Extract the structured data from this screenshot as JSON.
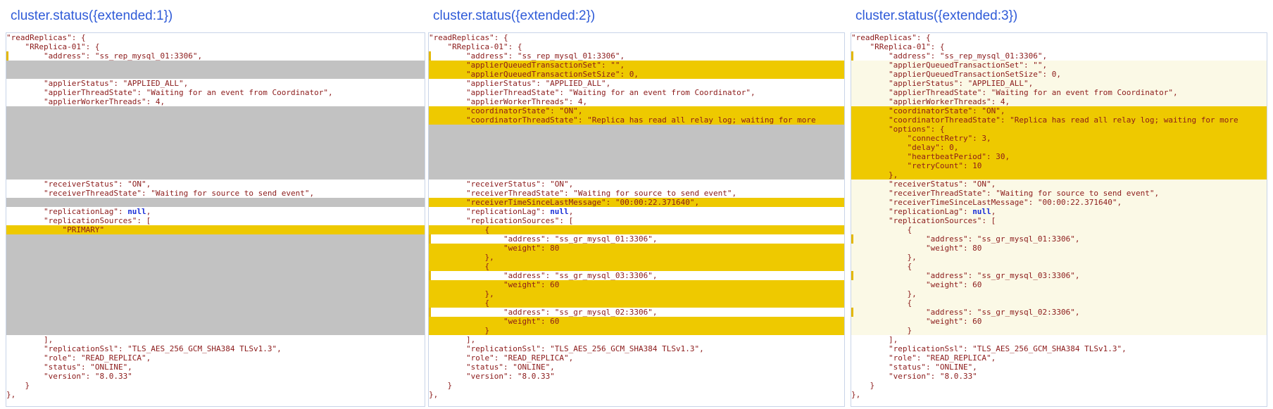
{
  "panels": [
    {
      "title": "cluster.status({extended:1})",
      "lines": [
        {
          "text": "\"readReplicas\": {",
          "hl": null
        },
        {
          "text": "    \"RReplica-01\": {",
          "hl": null
        },
        {
          "text": "        \"address\": \"ss_rep_mysql_01:3306\",",
          "hl": null,
          "mark": true
        },
        {
          "text": "",
          "hl": "grey"
        },
        {
          "text": "",
          "hl": "grey"
        },
        {
          "text": "        \"applierStatus\": \"APPLIED_ALL\",",
          "hl": null
        },
        {
          "text": "        \"applierThreadState\": \"Waiting for an event from Coordinator\",",
          "hl": null
        },
        {
          "text": "        \"applierWorkerThreads\": 4,",
          "hl": null
        },
        {
          "text": "",
          "hl": "grey"
        },
        {
          "text": "",
          "hl": "grey"
        },
        {
          "text": "",
          "hl": "grey"
        },
        {
          "text": "",
          "hl": "grey"
        },
        {
          "text": "",
          "hl": "grey"
        },
        {
          "text": "",
          "hl": "grey"
        },
        {
          "text": "",
          "hl": "grey"
        },
        {
          "text": "",
          "hl": "grey"
        },
        {
          "text": "        \"receiverStatus\": \"ON\",",
          "hl": null
        },
        {
          "text": "        \"receiverThreadState\": \"Waiting for source to send event\",",
          "hl": null
        },
        {
          "text": "",
          "hl": "grey"
        },
        {
          "text": "        \"replicationLag\": null,",
          "hl": null
        },
        {
          "text": "        \"replicationSources\": [",
          "hl": null
        },
        {
          "text": "            \"PRIMARY\"",
          "hl": "yellow"
        },
        {
          "text": "",
          "hl": "grey"
        },
        {
          "text": "",
          "hl": "grey"
        },
        {
          "text": "",
          "hl": "grey"
        },
        {
          "text": "",
          "hl": "grey"
        },
        {
          "text": "",
          "hl": "grey"
        },
        {
          "text": "",
          "hl": "grey"
        },
        {
          "text": "",
          "hl": "grey"
        },
        {
          "text": "",
          "hl": "grey"
        },
        {
          "text": "",
          "hl": "grey"
        },
        {
          "text": "",
          "hl": "grey"
        },
        {
          "text": "",
          "hl": "grey"
        },
        {
          "text": "        ],",
          "hl": null
        },
        {
          "text": "        \"replicationSsl\": \"TLS_AES_256_GCM_SHA384 TLSv1.3\",",
          "hl": null
        },
        {
          "text": "        \"role\": \"READ_REPLICA\",",
          "hl": null
        },
        {
          "text": "        \"status\": \"ONLINE\",",
          "hl": null
        },
        {
          "text": "        \"version\": \"8.0.33\"",
          "hl": null
        },
        {
          "text": "    }",
          "hl": null
        },
        {
          "text": "},",
          "hl": null
        }
      ]
    },
    {
      "title": "cluster.status({extended:2})",
      "lines": [
        {
          "text": "\"readReplicas\": {",
          "hl": null
        },
        {
          "text": "    \"RReplica-01\": {",
          "hl": null
        },
        {
          "text": "        \"address\": \"ss_rep_mysql_01:3306\",",
          "hl": null,
          "mark": true
        },
        {
          "text": "        \"applierQueuedTransactionSet\": \"\",",
          "hl": "yellow"
        },
        {
          "text": "        \"applierQueuedTransactionSetSize\": 0,",
          "hl": "yellow"
        },
        {
          "text": "        \"applierStatus\": \"APPLIED_ALL\",",
          "hl": null
        },
        {
          "text": "        \"applierThreadState\": \"Waiting for an event from Coordinator\",",
          "hl": null
        },
        {
          "text": "        \"applierWorkerThreads\": 4,",
          "hl": null
        },
        {
          "text": "        \"coordinatorState\": \"ON\",",
          "hl": "yellow"
        },
        {
          "text": "        \"coordinatorThreadState\": \"Replica has read all relay log; waiting for more",
          "hl": "yellow"
        },
        {
          "text": "",
          "hl": "grey"
        },
        {
          "text": "",
          "hl": "grey"
        },
        {
          "text": "",
          "hl": "grey"
        },
        {
          "text": "",
          "hl": "grey"
        },
        {
          "text": "",
          "hl": "grey"
        },
        {
          "text": "",
          "hl": "grey"
        },
        {
          "text": "        \"receiverStatus\": \"ON\",",
          "hl": null
        },
        {
          "text": "        \"receiverThreadState\": \"Waiting for source to send event\",",
          "hl": null
        },
        {
          "text": "        \"receiverTimeSinceLastMessage\": \"00:00:22.371640\",",
          "hl": "yellow"
        },
        {
          "text": "        \"replicationLag\": null,",
          "hl": null
        },
        {
          "text": "        \"replicationSources\": [",
          "hl": null
        },
        {
          "text": "            {",
          "hl": "yellow"
        },
        {
          "text": "                \"address\": \"ss_gr_mysql_01:3306\",",
          "hl": null,
          "mark": true
        },
        {
          "text": "                \"weight\": 80",
          "hl": "yellow"
        },
        {
          "text": "            },",
          "hl": "yellow"
        },
        {
          "text": "            {",
          "hl": "yellow"
        },
        {
          "text": "                \"address\": \"ss_gr_mysql_03:3306\",",
          "hl": null,
          "mark": true
        },
        {
          "text": "                \"weight\": 60",
          "hl": "yellow"
        },
        {
          "text": "            },",
          "hl": "yellow"
        },
        {
          "text": "            {",
          "hl": "yellow"
        },
        {
          "text": "                \"address\": \"ss_gr_mysql_02:3306\",",
          "hl": null,
          "mark": true
        },
        {
          "text": "                \"weight\": 60",
          "hl": "yellow"
        },
        {
          "text": "            }",
          "hl": "yellow"
        },
        {
          "text": "        ],",
          "hl": null
        },
        {
          "text": "        \"replicationSsl\": \"TLS_AES_256_GCM_SHA384 TLSv1.3\",",
          "hl": null
        },
        {
          "text": "        \"role\": \"READ_REPLICA\",",
          "hl": null
        },
        {
          "text": "        \"status\": \"ONLINE\",",
          "hl": null
        },
        {
          "text": "        \"version\": \"8.0.33\"",
          "hl": null
        },
        {
          "text": "    }",
          "hl": null
        },
        {
          "text": "},",
          "hl": null
        }
      ]
    },
    {
      "title": "cluster.status({extended:3})",
      "lines": [
        {
          "text": "\"readReplicas\": {",
          "hl": null
        },
        {
          "text": "    \"RReplica-01\": {",
          "hl": null
        },
        {
          "text": "        \"address\": \"ss_rep_mysql_01:3306\",",
          "hl": null,
          "mark": true
        },
        {
          "text": "        \"applierQueuedTransactionSet\": \"\",",
          "hl": "pale"
        },
        {
          "text": "        \"applierQueuedTransactionSetSize\": 0,",
          "hl": "pale"
        },
        {
          "text": "        \"applierStatus\": \"APPLIED_ALL\",",
          "hl": "pale"
        },
        {
          "text": "        \"applierThreadState\": \"Waiting for an event from Coordinator\",",
          "hl": "pale"
        },
        {
          "text": "        \"applierWorkerThreads\": 4,",
          "hl": "pale"
        },
        {
          "text": "        \"coordinatorState\": \"ON\",",
          "hl": "yellow"
        },
        {
          "text": "        \"coordinatorThreadState\": \"Replica has read all relay log; waiting for more",
          "hl": "yellow"
        },
        {
          "text": "        \"options\": {",
          "hl": "yellow"
        },
        {
          "text": "            \"connectRetry\": 3,",
          "hl": "yellow"
        },
        {
          "text": "            \"delay\": 0,",
          "hl": "yellow"
        },
        {
          "text": "            \"heartbeatPeriod\": 30,",
          "hl": "yellow"
        },
        {
          "text": "            \"retryCount\": 10",
          "hl": "yellow"
        },
        {
          "text": "        },",
          "hl": "yellow"
        },
        {
          "text": "        \"receiverStatus\": \"ON\",",
          "hl": "pale"
        },
        {
          "text": "        \"receiverThreadState\": \"Waiting for source to send event\",",
          "hl": "pale"
        },
        {
          "text": "        \"receiverTimeSinceLastMessage\": \"00:00:22.371640\",",
          "hl": "pale"
        },
        {
          "text": "        \"replicationLag\": null,",
          "hl": "pale"
        },
        {
          "text": "        \"replicationSources\": [",
          "hl": "pale"
        },
        {
          "text": "            {",
          "hl": "pale"
        },
        {
          "text": "                \"address\": \"ss_gr_mysql_01:3306\",",
          "hl": "pale",
          "mark": true
        },
        {
          "text": "                \"weight\": 80",
          "hl": "pale"
        },
        {
          "text": "            },",
          "hl": "pale"
        },
        {
          "text": "            {",
          "hl": "pale"
        },
        {
          "text": "                \"address\": \"ss_gr_mysql_03:3306\",",
          "hl": "pale",
          "mark": true
        },
        {
          "text": "                \"weight\": 60",
          "hl": "pale"
        },
        {
          "text": "            },",
          "hl": "pale"
        },
        {
          "text": "            {",
          "hl": "pale"
        },
        {
          "text": "                \"address\": \"ss_gr_mysql_02:3306\",",
          "hl": "pale",
          "mark": true
        },
        {
          "text": "                \"weight\": 60",
          "hl": "pale"
        },
        {
          "text": "            }",
          "hl": "pale"
        },
        {
          "text": "        ],",
          "hl": null
        },
        {
          "text": "        \"replicationSsl\": \"TLS_AES_256_GCM_SHA384 TLSv1.3\",",
          "hl": null
        },
        {
          "text": "        \"role\": \"READ_REPLICA\",",
          "hl": null
        },
        {
          "text": "        \"status\": \"ONLINE\",",
          "hl": null
        },
        {
          "text": "        \"version\": \"8.0.33\"",
          "hl": null
        },
        {
          "text": "    }",
          "hl": null
        },
        {
          "text": "},",
          "hl": null
        }
      ]
    }
  ],
  "colors": {
    "title": "#2f5bd8",
    "code_text": "#8b1a1a",
    "keyword": "#1a2fd8",
    "highlight_grey": "#c2c2c2",
    "highlight_yellow": "#eec900",
    "highlight_pale": "#fbf9e6"
  }
}
